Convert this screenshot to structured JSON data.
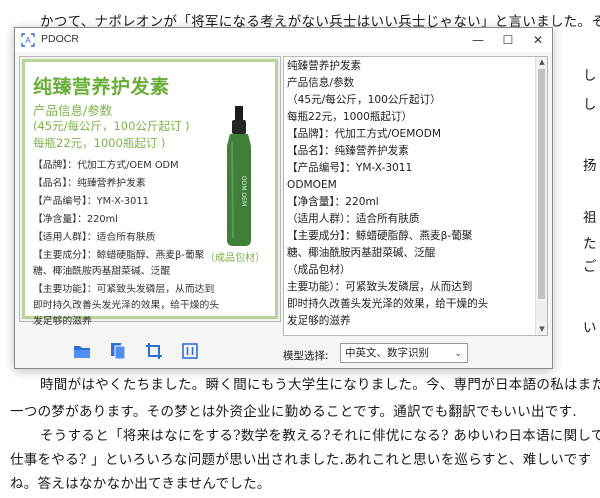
{
  "document": {
    "lines_top": [
      "かつて、ナポレオンが「将军になる考えがない兵士はいい兵士じゃない」と言いました。そ"
    ],
    "right_edge": [
      "し",
      "し",
      "扬",
      "祖",
      "た",
      "ご",
      "い"
    ],
    "lines_bottom": [
      "時間がはやくたちました。瞬く間にもう大学生になりました。今、専門が日本語の私はまた",
      "一つの梦があります。その梦とは外资企业に勤めることです。通訳でも翻訳でもいい出です.",
      "そうすると「将来はなにをする?数学を教える?それに俳优になる? あゆいわ日本语に関して",
      "仕事をやる? 」といろいろな问题が思い出されました.あれこれと思いを巡らすと、难しいです",
      "ね。答えはなかなか出てきませんでした。"
    ]
  },
  "window": {
    "title": "PDOCR",
    "controls": {
      "minimize": "—",
      "maximize": "☐",
      "close": "✕"
    }
  },
  "product_image": {
    "title": "纯臻营养护发素",
    "subtitle": "产品信息/参数",
    "price1": "(45元/每公斤，100公斤起订 )",
    "price2": "每瓶22元，1000瓶起订 )",
    "details": [
      "【品牌】：代加工方式/OEM ODM",
      "【品名】：纯臻营养护发素",
      "【产品编号】：YM-X-3011",
      "【净含量】：220ml",
      "【适用人群】：适合所有肤质",
      "【主要成分】：鲸蜡硬脂醇、燕麦β-葡聚",
      "糖、椰油酰胺丙基甜菜碱、泛醌",
      "【主要功能】：可紧致头发磷层，从而达到",
      "即时持久改善头发光泽的效果，给干燥的头",
      "发足够的滋养"
    ],
    "caption": "（成品包材）",
    "bottle_label": "ODM OEM"
  },
  "ocr_text": {
    "lines": [
      "纯臻营养护发素",
      "产品信息/参数",
      "（45元/每公斤，100公斤起订）",
      "每瓶22元，1000瓶起订）",
      "【品牌】：代加工方式/OEMODM",
      "【品名】：纯臻营养护发素",
      "【产品编号】：YM-X-3011",
      "ODMOEM",
      "【净含量】：220ml",
      "（适用人群）：适合所有肤质",
      "【主要成分】：鲸蜡硬脂醇、燕麦β-葡聚",
      "糖、椰油酰胺丙基甜菜碱、泛醌",
      "（成品包材）",
      "主要功能）：可紧致头发磷层，从而达到",
      "即时持久改善头发光泽的效果，给干燥的头",
      "发足够的滋养"
    ]
  },
  "toolbar": {
    "model_label": "模型选择:",
    "model_value": "中英文、数字识别"
  },
  "colors": {
    "accent_green": "#6aae3a",
    "icon_blue": "#2f6fd8"
  },
  "icons": [
    "folder-icon",
    "copy-icon",
    "crop-icon",
    "columns-icon"
  ]
}
